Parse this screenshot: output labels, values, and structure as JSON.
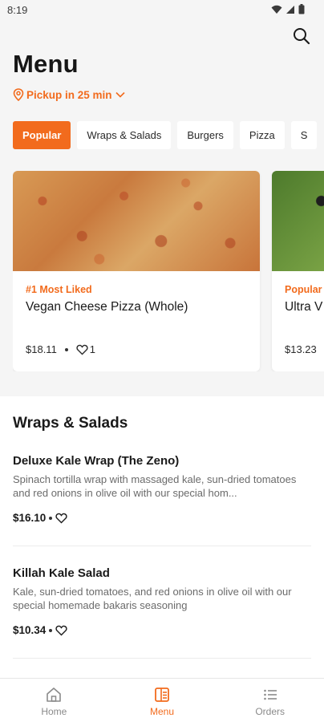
{
  "status_bar": {
    "time": "8:19",
    "icons": [
      "wifi-icon",
      "signal-icon",
      "battery-icon"
    ]
  },
  "header": {
    "title": "Menu",
    "search_icon": "search-icon"
  },
  "pickup": {
    "label": "Pickup in 25 min",
    "icon": "location-pin-icon",
    "chevron": "chevron-down-icon"
  },
  "tabs": [
    {
      "label": "Popular",
      "active": true
    },
    {
      "label": "Wraps & Salads",
      "active": false
    },
    {
      "label": "Burgers",
      "active": false
    },
    {
      "label": "Pizza",
      "active": false
    },
    {
      "label": "S",
      "active": false
    }
  ],
  "featured": [
    {
      "tag": "#1 Most Liked",
      "name": "Vegan Cheese Pizza (Whole)",
      "price": "$18.11",
      "likes": "1"
    },
    {
      "tag": "Popular",
      "name": "Ultra V",
      "price": "$13.23"
    }
  ],
  "section": {
    "title": "Wraps & Salads",
    "items": [
      {
        "name": "Deluxe Kale Wrap (The Zeno)",
        "description": "Spinach tortilla wrap with massaged kale, sun-dried tomatoes and red onions in olive oil with our special hom...",
        "price": "$16.10"
      },
      {
        "name": "Killah Kale Salad",
        "description": "Kale, sun-dried tomatoes, and red onions in olive oil with our special homemade bakaris seasoning",
        "price": "$10.34"
      }
    ]
  },
  "bottom_nav": [
    {
      "label": "Home",
      "icon": "home-icon",
      "active": false
    },
    {
      "label": "Menu",
      "icon": "menu-icon",
      "active": true
    },
    {
      "label": "Orders",
      "icon": "orders-icon",
      "active": false
    }
  ],
  "colors": {
    "accent": "#f26b1d",
    "background": "#f5f5f5",
    "text": "#1a1a1a",
    "muted": "#6b6b6b"
  }
}
